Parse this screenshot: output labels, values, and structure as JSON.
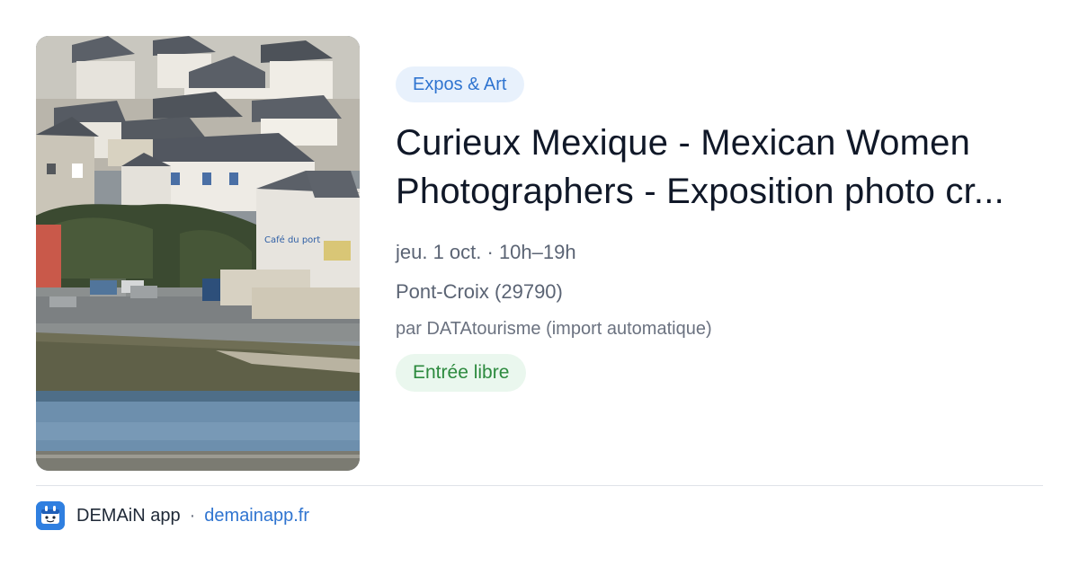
{
  "event": {
    "category": "Expos & Art",
    "title": "Curieux Mexique - Mexican Women Photographers - Exposition photo cr...",
    "date": "jeu. 1 oct. · 10h–19h",
    "place": "Pont-Croix (29790)",
    "source": "par DATAtourisme (import automatique)",
    "price": "Entrée libre",
    "image_sign": "Café du port"
  },
  "footer": {
    "app_name": "DEMAiN app",
    "separator": "·",
    "url": "demainapp.fr"
  },
  "colors": {
    "accent": "#2f74d0",
    "category_bg": "#e8f1fc",
    "price_bg": "#eaf7ee",
    "price_text": "#2c8a3e"
  },
  "icons": {
    "app_logo": "demain-app-logo-icon"
  }
}
